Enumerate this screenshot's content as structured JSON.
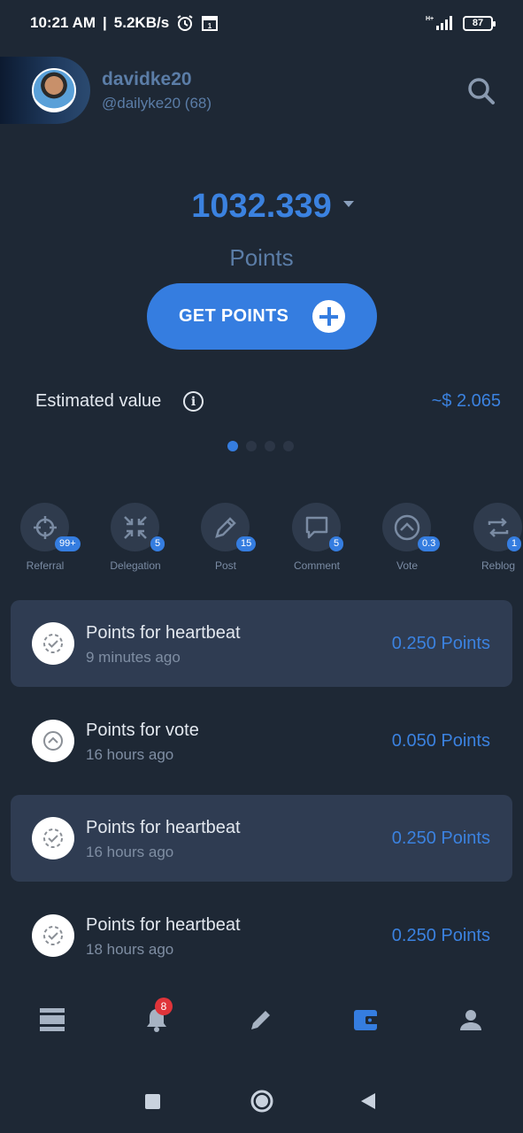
{
  "status_bar": {
    "time": "10:21 AM",
    "separator": "|",
    "speed": "5.2KB/s",
    "battery": "87"
  },
  "profile": {
    "username": "davidke20",
    "handle": "@dailyke20 (68)"
  },
  "balance": {
    "value": "1032.339",
    "label": "Points"
  },
  "get_points_label": "GET POINTS",
  "estimate": {
    "label": "Estimated value",
    "value": "~$ 2.065"
  },
  "pager": {
    "pages": 4,
    "active": 1
  },
  "actions": [
    {
      "label": "Referral",
      "badge": "99+",
      "icon": "crosshair-icon"
    },
    {
      "label": "Delegation",
      "badge": "5",
      "icon": "compress-arrows-icon"
    },
    {
      "label": "Post",
      "badge": "15",
      "icon": "pencil-icon"
    },
    {
      "label": "Comment",
      "badge": "5",
      "icon": "comment-icon"
    },
    {
      "label": "Vote",
      "badge": "0.3",
      "icon": "chevron-up-circle-icon"
    },
    {
      "label": "Reblog",
      "badge": "1",
      "icon": "repeat-icon"
    }
  ],
  "transactions": [
    {
      "title": "Points for heartbeat",
      "time": "9 minutes ago",
      "amount": "0.250 Points",
      "icon": "heartbeat-check-icon",
      "highlight": true
    },
    {
      "title": "Points for vote",
      "time": "16 hours ago",
      "amount": "0.050 Points",
      "icon": "vote-icon",
      "highlight": false
    },
    {
      "title": "Points for heartbeat",
      "time": "16 hours ago",
      "amount": "0.250 Points",
      "icon": "heartbeat-check-icon",
      "highlight": true
    },
    {
      "title": "Points for heartbeat",
      "time": "18 hours ago",
      "amount": "0.250 Points",
      "icon": "heartbeat-check-icon",
      "highlight": false
    }
  ],
  "bottom_nav": {
    "notification_count": "8",
    "items": [
      "feed-icon",
      "bell-icon",
      "edit-icon",
      "wallet-icon",
      "profile-icon"
    ],
    "active": "wallet-icon"
  },
  "colors": {
    "background": "#1e2835",
    "accent": "#357de0",
    "row_highlight": "#2f3c52",
    "badge_red": "#e0343a"
  }
}
